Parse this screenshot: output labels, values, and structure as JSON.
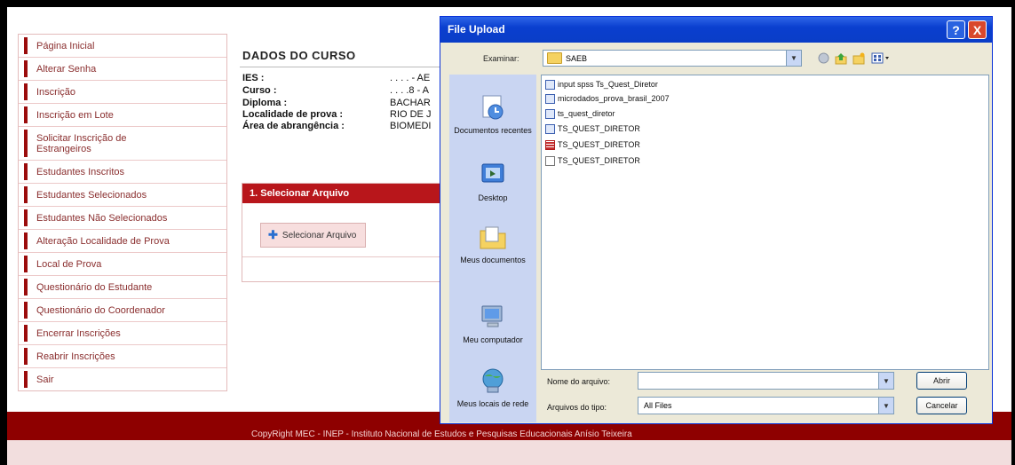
{
  "sidebar": {
    "items": [
      {
        "label": "Página Inicial"
      },
      {
        "label": "Alterar Senha"
      },
      {
        "label": "Inscrição"
      },
      {
        "label": "Inscrição em Lote"
      },
      {
        "label": "Solicitar Inscrição de Estrangeiros"
      },
      {
        "label": "Estudantes Inscritos"
      },
      {
        "label": "Estudantes Selecionados"
      },
      {
        "label": "Estudantes Não Selecionados"
      },
      {
        "label": "Alteração Localidade de Prova"
      },
      {
        "label": "Local de Prova"
      },
      {
        "label": "Questionário do Estudante"
      },
      {
        "label": "Questionário do Coordenador"
      },
      {
        "label": "Encerrar Inscrições"
      },
      {
        "label": "Reabrir Inscrições"
      },
      {
        "label": "Sair"
      }
    ]
  },
  "course": {
    "title": "DADOS DO CURSO",
    "rows": [
      {
        "key": "IES :",
        "value": ". . . . - AE"
      },
      {
        "key": "Curso :",
        "value": ". . . .8 - A"
      },
      {
        "key": "Diploma :",
        "value": "BACHAR"
      },
      {
        "key": "Localidade de prova :",
        "value": "RIO DE J"
      },
      {
        "key": "Área de abrangência :",
        "value": "BIOMEDI"
      }
    ]
  },
  "select_panel": {
    "header": "1. Selecionar Arquivo",
    "button": "Selecionar Arquivo"
  },
  "footer": {
    "text": "CopyRight MEC - INEP - Instituto Nacional de Estudos e Pesquisas Educacionais Anísio Teixeira"
  },
  "dialog": {
    "title": "File Upload",
    "help": "?",
    "close": "X",
    "look_in_label": "Examinar:",
    "look_in_value": "SAEB",
    "places": [
      {
        "label": "Documentos recentes"
      },
      {
        "label": "Desktop"
      },
      {
        "label": "Meus documentos"
      },
      {
        "label": "Meu computador"
      },
      {
        "label": "Meus locais de rede"
      }
    ],
    "files": [
      {
        "name": "input spss Ts_Quest_Diretor",
        "icon": "spss-syntax-icon"
      },
      {
        "name": "microdados_prova_brasil_2007",
        "icon": "spss-data-icon"
      },
      {
        "name": "ts_quest_diretor",
        "icon": "spss-output-icon"
      },
      {
        "name": "TS_QUEST_DIRETOR",
        "icon": "spss-data-icon"
      },
      {
        "name": "TS_QUEST_DIRETOR",
        "icon": "spreadsheet-icon"
      },
      {
        "name": "TS_QUEST_DIRETOR",
        "icon": "text-file-icon"
      }
    ],
    "filename_label": "Nome do arquivo:",
    "filename_value": "",
    "filetype_label": "Arquivos do tipo:",
    "filetype_value": "All Files",
    "open_label": "Abrir",
    "cancel_label": "Cancelar"
  }
}
